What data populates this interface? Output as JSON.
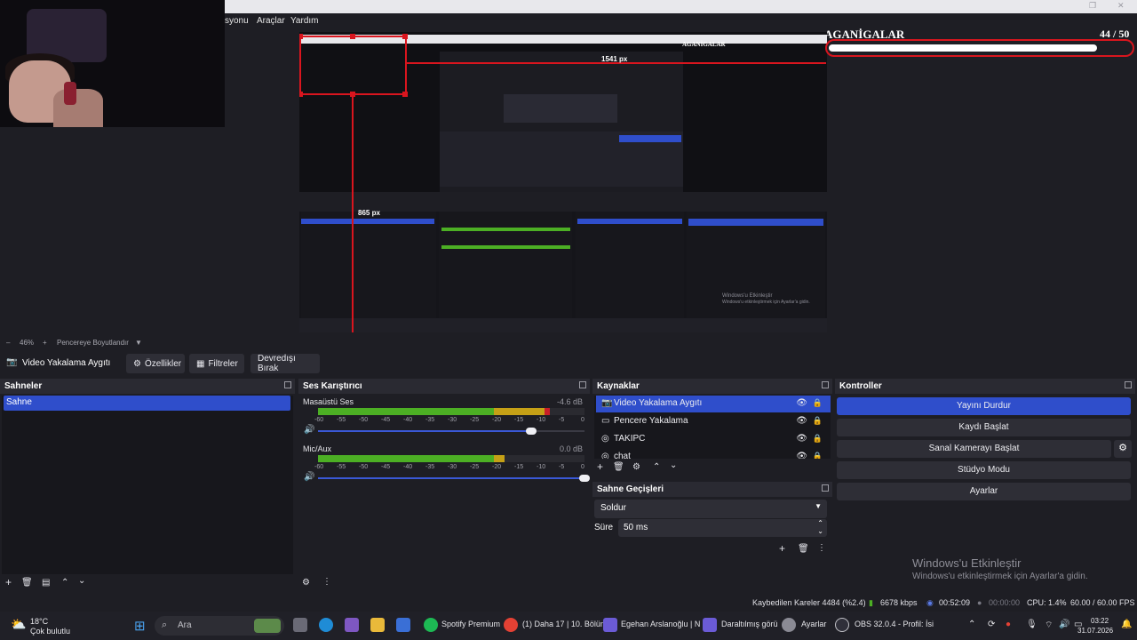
{
  "window": {
    "menu": [
      "syonu",
      "Araçlar",
      "Yardım"
    ],
    "brand": "AGANİGALAR",
    "counter": "44 / 50"
  },
  "preview": {
    "px_label_top": "1541 px",
    "px_label_mid": "865 px",
    "nested_brand": "AGANİGALAR",
    "nested_activate1": "Windows'u Etkinleştir",
    "nested_activate2": "Windows'u etkinleştirmek için Ayarlar'a gidin."
  },
  "zoom": {
    "minus": "–",
    "level": "46%",
    "plus": "+",
    "fit_label": "Pencereye Boyutlandır",
    "dropdown_glyph": "▼"
  },
  "source_toolbar": {
    "source_name": "Video Yakalama Aygıtı",
    "properties": "Özellikler",
    "filters": "Filtreler",
    "deactivate": "Devredışı Bırak"
  },
  "scenes": {
    "title": "Sahneler",
    "items": [
      "Sahne"
    ]
  },
  "mixer": {
    "title": "Ses Karıştırıcı",
    "channels": [
      {
        "name": "Masaüstü Ses",
        "db": "-4.6 dB",
        "level": 0.87,
        "volume": 0.8
      },
      {
        "name": "Mic/Aux",
        "db": "0.0 dB",
        "level": 0.7,
        "volume": 1.0
      }
    ],
    "scale": [
      "-60",
      "-55",
      "-50",
      "-45",
      "-40",
      "-35",
      "-30",
      "-25",
      "-20",
      "-15",
      "-10",
      "-5",
      "0"
    ]
  },
  "sources": {
    "title": "Kaynaklar",
    "items": [
      "Video Yakalama Aygıtı",
      "Pencere Yakalama",
      "TAKIPC",
      "chat"
    ]
  },
  "transitions": {
    "title": "Sahne Geçişleri",
    "selected": "Soldur",
    "duration_label": "Süre",
    "duration_value": "50 ms"
  },
  "controls": {
    "title": "Kontroller",
    "buttons": [
      "Yayını Durdur",
      "Kaydı Başlat",
      "Sanal Kamerayı Başlat",
      "Stüdyo Modu",
      "Ayarlar"
    ]
  },
  "activation": {
    "line1": "Windows'u Etkinleştir",
    "line2": "Windows'u etkinleştirmek için Ayarlar'a gidin."
  },
  "status": {
    "dropped": "Kaybedilen Kareler 4484 (%2.4)",
    "bitrate": "6678 kbps",
    "stream_time": "00:52:09",
    "rec_time": "00:00:00",
    "cpu": "CPU: 1.4%",
    "fps": "60.00 / 60.00 FPS"
  },
  "taskbar": {
    "weather_temp": "18°C",
    "weather_desc": "Çok bulutlu",
    "search_placeholder": "Ara",
    "apps": [
      "Spotify Premium",
      "(1) Daha 17 | 10. Bölüm",
      "Egehan Arslanoğlu | N",
      "Daraltılmış görü",
      "Ayarlar",
      "OBS 32.0.4 - Profil: İsi"
    ],
    "time": "03:22",
    "date": "31.07.2026"
  },
  "colors": {
    "accent": "#2f4ecb",
    "background": "#1e1e24",
    "panel": "#17171c",
    "selection_red": "#d9151e",
    "meter_green": "#4caf24",
    "meter_yellow": "#c5a016",
    "meter_red": "#c81e28"
  }
}
